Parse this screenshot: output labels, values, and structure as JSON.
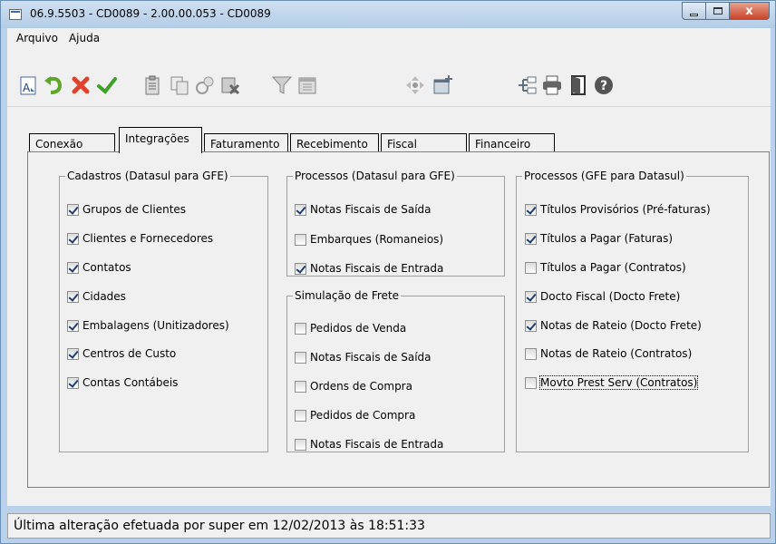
{
  "window": {
    "title": "06.9.5503 - CD0089 - 2.00.00.053 - CD0089",
    "close_glyph": "x"
  },
  "menu": {
    "items": [
      "Arquivo",
      "Ajuda"
    ]
  },
  "tabs": [
    "Conexão",
    "Integrações",
    "Faturamento",
    "Recebimento",
    "Fiscal",
    "Financeiro"
  ],
  "active_tab": "Integrações",
  "groups": {
    "cadastros": {
      "title": "Cadastros (Datasul para GFE)",
      "items": [
        {
          "label": "Grupos de Clientes",
          "checked": true
        },
        {
          "label": "Clientes e Fornecedores",
          "checked": true
        },
        {
          "label": "Contatos",
          "checked": true
        },
        {
          "label": "Cidades",
          "checked": true
        },
        {
          "label": "Embalagens (Unitizadores)",
          "checked": true
        },
        {
          "label": "Centros de Custo",
          "checked": true
        },
        {
          "label": "Contas Contábeis",
          "checked": true
        }
      ]
    },
    "processos_datasul": {
      "title": "Processos (Datasul para GFE)",
      "items": [
        {
          "label": "Notas Fiscais de Saída",
          "checked": true
        },
        {
          "label": "Embarques (Romaneios)",
          "checked": false
        },
        {
          "label": "Notas Fiscais de Entrada",
          "checked": true
        }
      ]
    },
    "simulacao": {
      "title": "Simulação de Frete",
      "items": [
        {
          "label": "Pedidos de Venda",
          "checked": false
        },
        {
          "label": "Notas Fiscais de Saída",
          "checked": false
        },
        {
          "label": "Ordens de Compra",
          "checked": false
        },
        {
          "label": "Pedidos de Compra",
          "checked": false
        },
        {
          "label": "Notas Fiscais de Entrada",
          "checked": false
        }
      ]
    },
    "processos_gfe": {
      "title": "Processos (GFE para Datasul)",
      "items": [
        {
          "label": "Títulos Provisórios (Pré-faturas)",
          "checked": true
        },
        {
          "label": "Títulos a Pagar (Faturas)",
          "checked": true
        },
        {
          "label": "Títulos a Pagar (Contratos)",
          "checked": false
        },
        {
          "label": "Docto Fiscal (Docto Frete)",
          "checked": true
        },
        {
          "label": "Notas de Rateio (Docto Frete)",
          "checked": true
        },
        {
          "label": "Notas de Rateio (Contratos)",
          "checked": false
        },
        {
          "label": "Movto Prest Serv (Contratos)",
          "checked": false
        }
      ]
    }
  },
  "status": "Última alteração efetuada por super em 12/02/2013 às 18:51:33",
  "colors": {
    "title_gradient": [
      "#cfe0f2",
      "#b3cce6"
    ],
    "close_button": "#c8452c",
    "window_bg": "#f0f0f0"
  }
}
